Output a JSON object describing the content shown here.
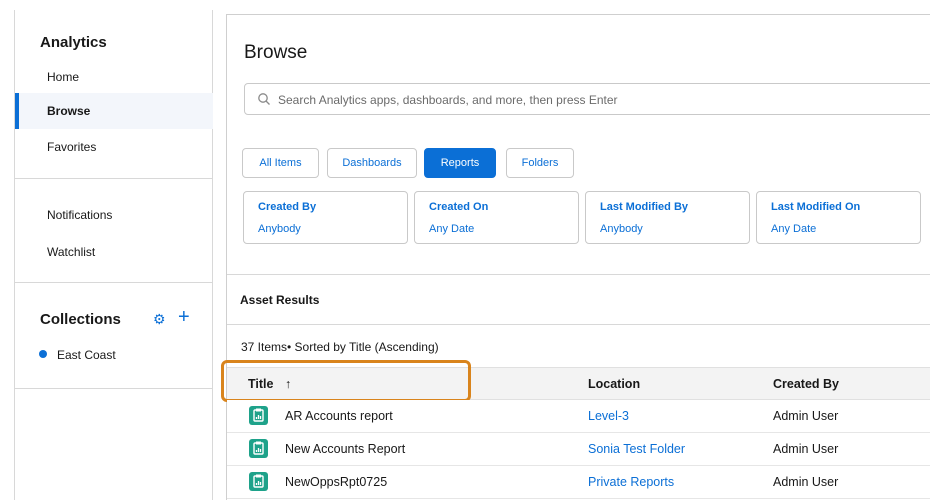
{
  "sidebar": {
    "app_title": "Analytics",
    "nav": [
      {
        "label": "Home"
      },
      {
        "label": "Browse",
        "active": true
      },
      {
        "label": "Favorites"
      }
    ],
    "nav2": [
      {
        "label": "Notifications"
      },
      {
        "label": "Watchlist"
      }
    ],
    "collections": {
      "title": "Collections",
      "settings_icon": "gear-icon",
      "add_icon": "plus-icon",
      "items": [
        {
          "label": "East Coast"
        }
      ]
    }
  },
  "main": {
    "title": "Browse",
    "search": {
      "placeholder": "Search Analytics apps, dashboards, and more, then press Enter",
      "icon": "search-icon"
    },
    "tabs": [
      {
        "label": "All Items"
      },
      {
        "label": "Dashboards"
      },
      {
        "label": "Reports",
        "active": true
      },
      {
        "label": "Folders"
      }
    ],
    "filters": [
      {
        "label": "Created By",
        "value": "Anybody"
      },
      {
        "label": "Created On",
        "value": "Any Date"
      },
      {
        "label": "Last Modified By",
        "value": "Anybody"
      },
      {
        "label": "Last Modified On",
        "value": "Any Date"
      }
    ],
    "asset_results_label": "Asset Results",
    "items_info": "37 Items• Sorted by Title (Ascending)",
    "table": {
      "columns": [
        {
          "label": "Title",
          "sort_icon": "arrow-up-icon"
        },
        {
          "label": "Location"
        },
        {
          "label": "Created By"
        }
      ],
      "rows": [
        {
          "title": "AR Accounts report",
          "location": "Level-3",
          "created_by": "Admin User"
        },
        {
          "title": "New Accounts Report",
          "location": "Sonia Test Folder",
          "created_by": "Admin User"
        },
        {
          "title": "NewOppsRpt0725",
          "location": "Private Reports",
          "created_by": "Admin User"
        }
      ]
    }
  },
  "colors": {
    "accent": "#0b6fd6",
    "highlight": "#d9841c",
    "report_icon": "#1ea28a"
  }
}
